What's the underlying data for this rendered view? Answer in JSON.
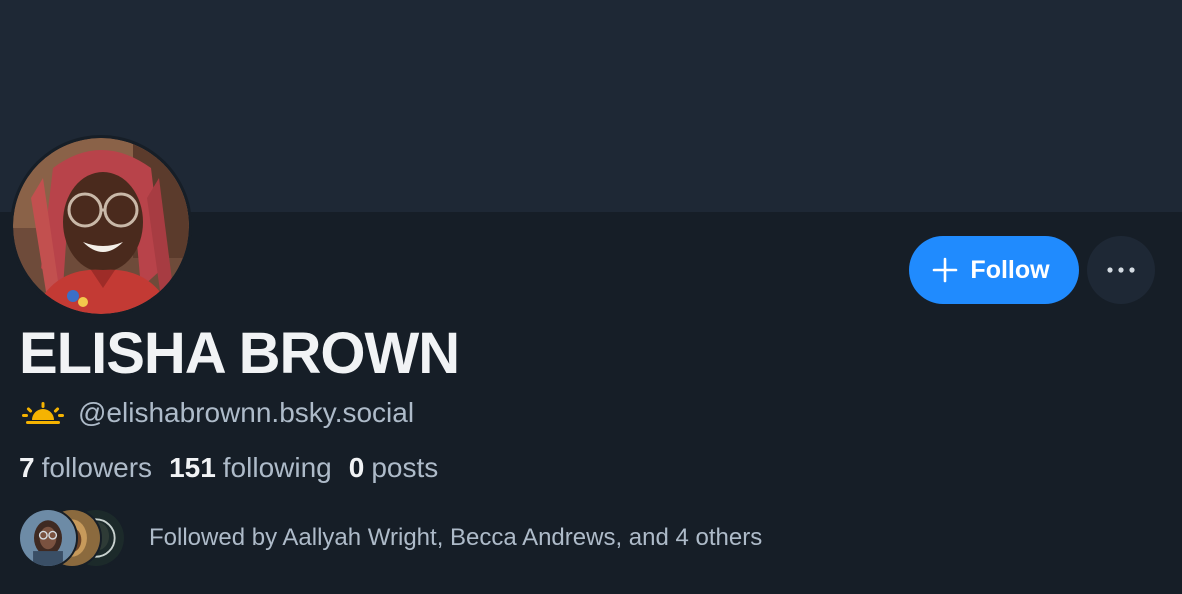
{
  "profile": {
    "display_name": "ELISHA BROWN",
    "handle": "@elishabrownn.bsky.social",
    "handle_emoji_icon": "sunrise-icon",
    "emoji_color": "#f5b301"
  },
  "actions": {
    "follow_label": "Follow",
    "follow_icon": "plus-icon",
    "more_icon": "ellipsis-icon",
    "accent_color": "#208bfe"
  },
  "stats": {
    "followers_count": "7",
    "followers_label": "followers",
    "following_count": "151",
    "following_label": "following",
    "posts_count": "0",
    "posts_label": "posts"
  },
  "followed_by": {
    "text": "Followed by Aallyah Wright, Becca Andrews, and 4 others"
  },
  "colors": {
    "page_background": "#161e27",
    "banner_background": "#1e2835",
    "primary_text": "#f1f3f5",
    "secondary_text": "#aebbc9"
  }
}
